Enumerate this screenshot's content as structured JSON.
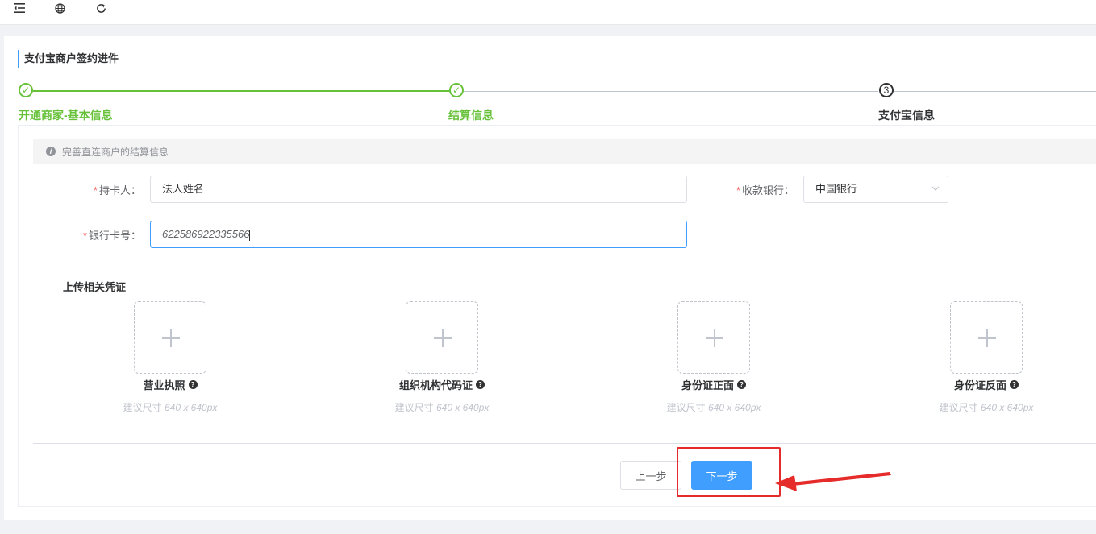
{
  "topbar": {
    "icons": [
      "menu-fold-icon",
      "globe-icon",
      "refresh-icon"
    ]
  },
  "page": {
    "title": "支付宝商户签约进件"
  },
  "steps": [
    {
      "index": "✓",
      "label": "开通商家-基本信息",
      "status": "done"
    },
    {
      "index": "✓",
      "label": "结算信息",
      "status": "done"
    },
    {
      "index": "3",
      "label": "支付宝信息",
      "status": "current"
    }
  ],
  "info": {
    "text": "完善直连商户的结算信息"
  },
  "form": {
    "cardholder": {
      "label": "持卡人：",
      "value": "法人姓名"
    },
    "bank": {
      "label": "收款银行：",
      "value": "中国银行"
    },
    "card_number": {
      "label": "银行卡号：",
      "value": "622586922335566"
    }
  },
  "upload": {
    "section_title": "上传相关凭证",
    "items": [
      {
        "label": "营业执照",
        "hint_prefix": "建议尺寸",
        "hint_size": "640 x 640px"
      },
      {
        "label": "组织机构代码证",
        "hint_prefix": "建议尺寸",
        "hint_size": "640 x 640px"
      },
      {
        "label": "身份证正面",
        "hint_prefix": "建议尺寸",
        "hint_size": "640 x 640px"
      },
      {
        "label": "身份证反面",
        "hint_prefix": "建议尺寸",
        "hint_size": "640 x 640px"
      }
    ]
  },
  "buttons": {
    "prev": "上一步",
    "next": "下一步"
  },
  "colors": {
    "primary": "#409eff",
    "success": "#67c23a",
    "annotation": "#e62b2b"
  }
}
